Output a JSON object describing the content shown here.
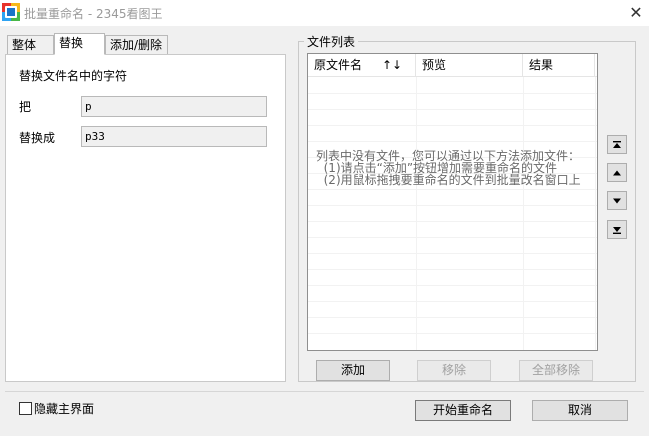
{
  "window": {
    "title": "批量重命名 - 2345看图王",
    "close_glyph": "✕"
  },
  "tabs": [
    {
      "label": "整体",
      "active": false
    },
    {
      "label": "替换",
      "active": true
    },
    {
      "label": "添加/删除",
      "active": false
    }
  ],
  "replace_panel": {
    "heading": "替换文件名中的字符",
    "find_label": "把",
    "find_value": "p",
    "replace_label": "替换成",
    "replace_value": "p33"
  },
  "file_list": {
    "group_title": "文件列表",
    "columns": [
      {
        "label": "原文件名"
      },
      {
        "label": "预览"
      },
      {
        "label": "结果"
      }
    ],
    "sort_indicator": "↑↓",
    "empty_message": "列表中没有文件，您可以通过以下方法添加文件：\n  (1)请点击“添加”按钮增加需要重命名的文件\n  (2)用鼠标拖拽要重命名的文件到批量改名窗口上"
  },
  "list_actions": {
    "add_label": "添加",
    "remove_label": "移除",
    "remove_all_label": "全部移除"
  },
  "side_buttons": [
    {
      "icon": "move-to-top-icon"
    },
    {
      "icon": "move-up-icon"
    },
    {
      "icon": "move-down-icon"
    },
    {
      "icon": "move-to-bottom-icon"
    }
  ],
  "footer": {
    "hide_main_label": "隐藏主界面",
    "hide_main_checked": false,
    "start_label": "开始重命名",
    "cancel_label": "取消"
  },
  "colors": {
    "disabled_text": "#a0a0a0",
    "title_text": "#9a9a9a"
  }
}
